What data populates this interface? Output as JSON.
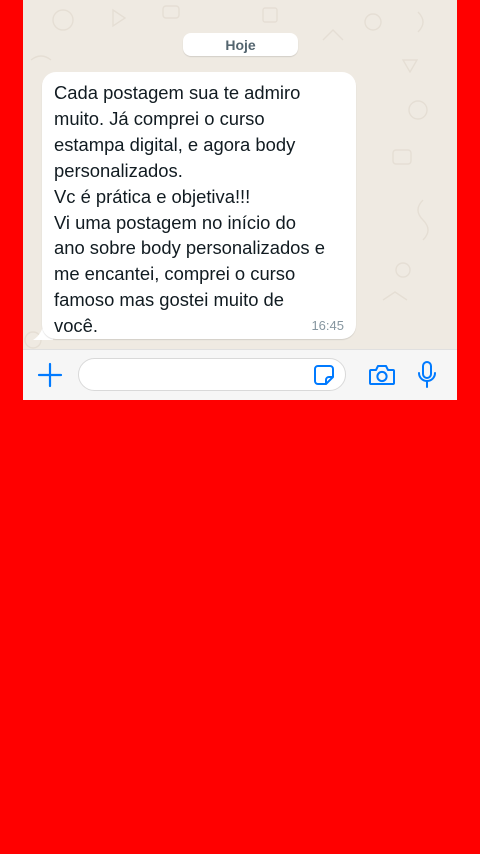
{
  "date_chip": {
    "label": "Hoje"
  },
  "message": {
    "text": "Cada postagem sua te admiro\nmuito. Já comprei o curso\nestampa digital, e agora body\npersonalizados.\nVc é prática e objetiva!!!\nVi uma postagem no início do\nano sobre body personalizados e\nme encantei, comprei o curso\nfamoso mas gostei muito de\nvocê.",
    "time": "16:45"
  },
  "composer": {
    "input_value": "",
    "icons": [
      "plus-icon",
      "sticker-icon",
      "camera-icon",
      "microphone-icon"
    ]
  },
  "colors": {
    "background": "#ff0000",
    "chat_wallpaper": "#efeae2",
    "accent": "#007aff",
    "bubble": "#ffffff"
  }
}
